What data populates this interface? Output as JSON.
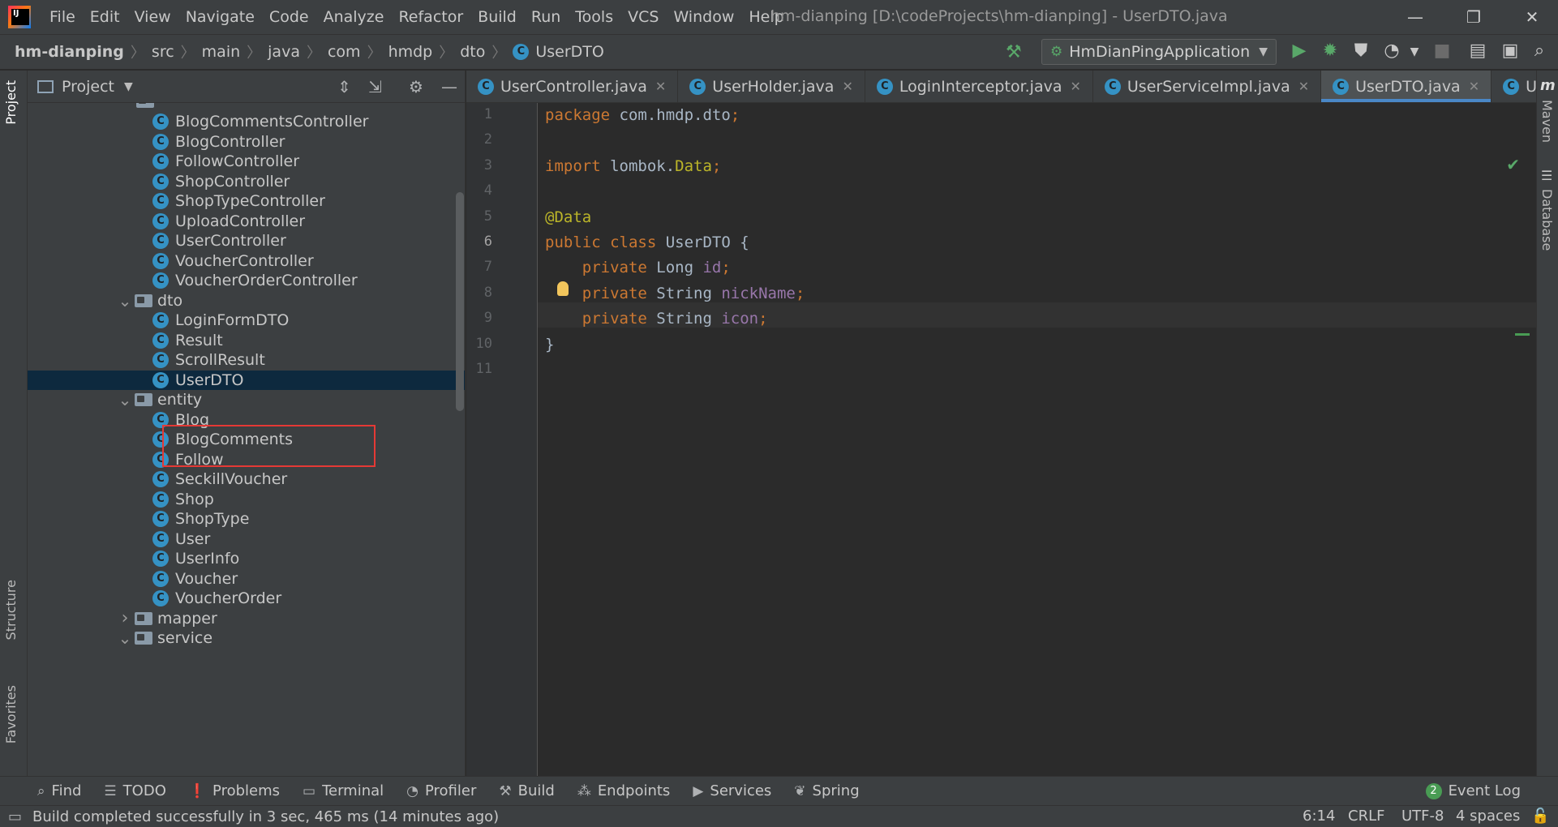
{
  "menu": {
    "items": [
      "File",
      "Edit",
      "View",
      "Navigate",
      "Code",
      "Analyze",
      "Refactor",
      "Build",
      "Run",
      "Tools",
      "VCS",
      "Window",
      "Help"
    ],
    "window_title": "hm-dianping [D:\\codeProjects\\hm-dianping] - UserDTO.java",
    "minimize": "—",
    "restore": "❐",
    "close": "✕"
  },
  "breadcrumb": {
    "project": "hm-dianping",
    "parts": [
      "src",
      "main",
      "java",
      "com",
      "hmdp",
      "dto"
    ],
    "current": "UserDTO",
    "sep": "〉"
  },
  "run_config": {
    "label": "HmDianPingApplication"
  },
  "project_panel": {
    "title": "Project",
    "tree": [
      {
        "label": "BlogCommentsController",
        "type": "class",
        "indent": 2
      },
      {
        "label": "BlogController",
        "type": "class",
        "indent": 2
      },
      {
        "label": "FollowController",
        "type": "class",
        "indent": 2
      },
      {
        "label": "ShopController",
        "type": "class",
        "indent": 2
      },
      {
        "label": "ShopTypeController",
        "type": "class",
        "indent": 2
      },
      {
        "label": "UploadController",
        "type": "class",
        "indent": 2
      },
      {
        "label": "UserController",
        "type": "class",
        "indent": 2
      },
      {
        "label": "VoucherController",
        "type": "class",
        "indent": 2
      },
      {
        "label": "VoucherOrderController",
        "type": "class",
        "indent": 2
      },
      {
        "label": "dto",
        "type": "folder-open",
        "indent": 1
      },
      {
        "label": "LoginFormDTO",
        "type": "class",
        "indent": 2
      },
      {
        "label": "Result",
        "type": "class",
        "indent": 2
      },
      {
        "label": "ScrollResult",
        "type": "class",
        "indent": 2
      },
      {
        "label": "UserDTO",
        "type": "class",
        "indent": 2,
        "selected": true
      },
      {
        "label": "entity",
        "type": "folder-open",
        "indent": 1
      },
      {
        "label": "Blog",
        "type": "class",
        "indent": 2
      },
      {
        "label": "BlogComments",
        "type": "class",
        "indent": 2
      },
      {
        "label": "Follow",
        "type": "class",
        "indent": 2
      },
      {
        "label": "SeckillVoucher",
        "type": "class",
        "indent": 2
      },
      {
        "label": "Shop",
        "type": "class",
        "indent": 2
      },
      {
        "label": "ShopType",
        "type": "class",
        "indent": 2
      },
      {
        "label": "User",
        "type": "class",
        "indent": 2
      },
      {
        "label": "UserInfo",
        "type": "class",
        "indent": 2
      },
      {
        "label": "Voucher",
        "type": "class",
        "indent": 2
      },
      {
        "label": "VoucherOrder",
        "type": "class",
        "indent": 2
      },
      {
        "label": "mapper",
        "type": "folder-closed",
        "indent": 1
      },
      {
        "label": "service",
        "type": "folder-open",
        "indent": 1
      }
    ]
  },
  "editor": {
    "tabs": [
      {
        "label": "UserController.java",
        "active": false
      },
      {
        "label": "UserHolder.java",
        "active": false
      },
      {
        "label": "LoginInterceptor.java",
        "active": false
      },
      {
        "label": "UserServiceImpl.java",
        "active": false
      },
      {
        "label": "UserDTO.java",
        "active": true
      },
      {
        "label": "User.java",
        "active": false
      }
    ],
    "current_line": 6,
    "lines": [
      [
        {
          "t": "package ",
          "c": "kw"
        },
        {
          "t": "com.hmdp.dto",
          "c": "plain"
        },
        {
          "t": ";",
          "c": "kw"
        }
      ],
      [],
      [
        {
          "t": "import ",
          "c": "kw"
        },
        {
          "t": "lombok.",
          "c": "plain"
        },
        {
          "t": "Data",
          "c": "ann"
        },
        {
          "t": ";",
          "c": "kw"
        }
      ],
      [],
      [
        {
          "t": "@Data",
          "c": "ann"
        }
      ],
      [
        {
          "t": "public class ",
          "c": "kw"
        },
        {
          "t": "UserDTO ",
          "c": "plain"
        },
        {
          "t": "{",
          "c": "plain"
        }
      ],
      [
        {
          "t": "    private ",
          "c": "kw"
        },
        {
          "t": "Long ",
          "c": "plain"
        },
        {
          "t": "id",
          "c": "fld"
        },
        {
          "t": ";",
          "c": "kw"
        }
      ],
      [
        {
          "t": "    private ",
          "c": "kw"
        },
        {
          "t": "String ",
          "c": "plain"
        },
        {
          "t": "nickName",
          "c": "fld"
        },
        {
          "t": ";",
          "c": "kw"
        }
      ],
      [
        {
          "t": "    private ",
          "c": "kw"
        },
        {
          "t": "String ",
          "c": "plain"
        },
        {
          "t": "icon",
          "c": "fld"
        },
        {
          "t": ";",
          "c": "kw"
        }
      ],
      [
        {
          "t": "}",
          "c": "plain"
        }
      ],
      []
    ]
  },
  "side_tabs": {
    "left": [
      "Project",
      "Structure",
      "Favorites"
    ],
    "right": [
      "Maven",
      "Database"
    ]
  },
  "bottom_tools": [
    {
      "label": "Find",
      "icon": "search-icon",
      "glyph": "⌕"
    },
    {
      "label": "TODO",
      "icon": "list-icon",
      "glyph": "☰"
    },
    {
      "label": "Problems",
      "icon": "info-icon",
      "glyph": "❗"
    },
    {
      "label": "Terminal",
      "icon": "terminal-icon",
      "glyph": "▭"
    },
    {
      "label": "Profiler",
      "icon": "profiler-icon",
      "glyph": "◔"
    },
    {
      "label": "Build",
      "icon": "hammer-icon",
      "glyph": "⚒"
    },
    {
      "label": "Endpoints",
      "icon": "endpoints-icon",
      "glyph": "⁂"
    },
    {
      "label": "Services",
      "icon": "services-icon",
      "glyph": "▶"
    },
    {
      "label": "Spring",
      "icon": "spring-icon",
      "glyph": "❦"
    }
  ],
  "event_log": {
    "count": "2",
    "label": "Event Log"
  },
  "status": {
    "message": "Build completed successfully in 3 sec, 465 ms (14 minutes ago)",
    "position": "6:14",
    "line_sep": "CRLF",
    "encoding": "UTF-8",
    "indent": "4 spaces"
  }
}
